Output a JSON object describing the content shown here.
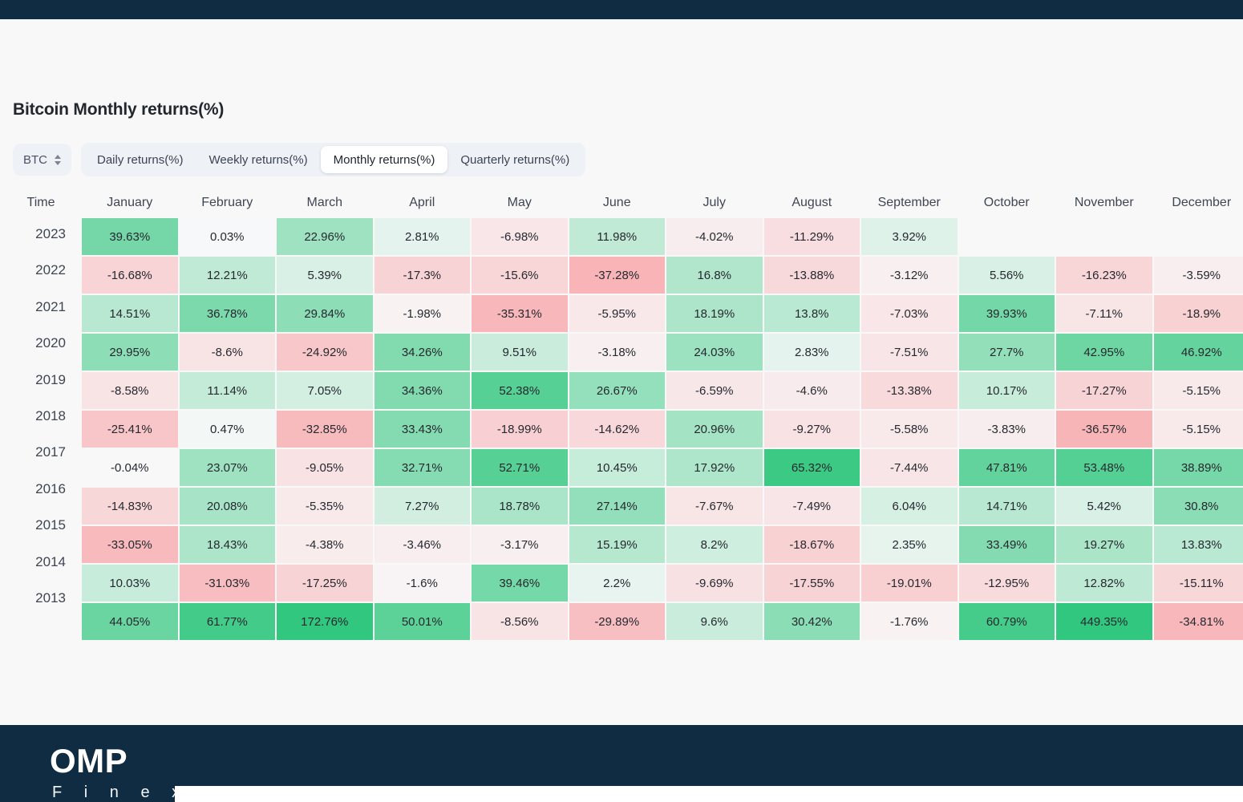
{
  "page": {
    "title": "Bitcoin Monthly returns(%)"
  },
  "toolbar": {
    "symbol_label": "BTC",
    "stepper_icon": "up-down-chevron-icon",
    "tabs": [
      {
        "label": "Daily returns(%)",
        "active": false
      },
      {
        "label": "Weekly returns(%)",
        "active": false
      },
      {
        "label": "Monthly returns(%)",
        "active": true
      },
      {
        "label": "Quarterly returns(%)",
        "active": false
      }
    ]
  },
  "footer": {
    "brand_primary": "OMP",
    "brand_secondary": "F i n e x",
    "background": "#0f2c42"
  },
  "colors": {
    "positive_max": "#32c77e",
    "negative_max": "#f8b4b7",
    "neutral": "#f8f8f9",
    "surface": "#f8f8f9",
    "tab_track": "#eef1f6",
    "tab_active": "#ffffff",
    "text": "#25292f"
  },
  "chart_data": {
    "type": "heatmap",
    "title": "Bitcoin Monthly returns(%)",
    "xlabel": "",
    "ylabel": "Time",
    "row_header": "Time",
    "categories": [
      "January",
      "February",
      "March",
      "April",
      "May",
      "June",
      "July",
      "August",
      "September",
      "October",
      "November",
      "December"
    ],
    "rows": [
      "2023",
      "2022",
      "2021",
      "2020",
      "2019",
      "2018",
      "2017",
      "2016",
      "2015",
      "2014",
      "2013"
    ],
    "unit": "%",
    "value_scale_positive_max": 449.35,
    "value_scale_negative_max": -37.28,
    "series": [
      {
        "name": "2023",
        "values": [
          39.63,
          0.03,
          22.96,
          2.81,
          -6.98,
          11.98,
          -4.02,
          -11.29,
          3.92,
          null,
          null,
          null
        ]
      },
      {
        "name": "2022",
        "values": [
          -16.68,
          12.21,
          5.39,
          -17.3,
          -15.6,
          -37.28,
          16.8,
          -13.88,
          -3.12,
          5.56,
          -16.23,
          -3.59
        ]
      },
      {
        "name": "2021",
        "values": [
          14.51,
          36.78,
          29.84,
          -1.98,
          -35.31,
          -5.95,
          18.19,
          13.8,
          -7.03,
          39.93,
          -7.11,
          -18.9
        ]
      },
      {
        "name": "2020",
        "values": [
          29.95,
          -8.6,
          -24.92,
          34.26,
          9.51,
          -3.18,
          24.03,
          2.83,
          -7.51,
          27.7,
          42.95,
          46.92
        ]
      },
      {
        "name": "2019",
        "values": [
          -8.58,
          11.14,
          7.05,
          34.36,
          52.38,
          26.67,
          -6.59,
          -4.6,
          -13.38,
          10.17,
          -17.27,
          -5.15
        ]
      },
      {
        "name": "2018",
        "values": [
          -25.41,
          0.47,
          -32.85,
          33.43,
          -18.99,
          -14.62,
          20.96,
          -9.27,
          -5.58,
          -3.83,
          -36.57,
          -5.15
        ]
      },
      {
        "name": "2017",
        "values": [
          -0.04,
          23.07,
          -9.05,
          32.71,
          52.71,
          10.45,
          17.92,
          65.32,
          -7.44,
          47.81,
          53.48,
          38.89
        ]
      },
      {
        "name": "2016",
        "values": [
          -14.83,
          20.08,
          -5.35,
          7.27,
          18.78,
          27.14,
          -7.67,
          -7.49,
          6.04,
          14.71,
          5.42,
          30.8
        ]
      },
      {
        "name": "2015",
        "values": [
          -33.05,
          18.43,
          -4.38,
          -3.46,
          -3.17,
          15.19,
          8.2,
          -18.67,
          2.35,
          33.49,
          19.27,
          13.83
        ]
      },
      {
        "name": "2014",
        "values": [
          10.03,
          -31.03,
          -17.25,
          -1.6,
          39.46,
          2.2,
          -9.69,
          -17.55,
          -19.01,
          -12.95,
          12.82,
          -15.11
        ]
      },
      {
        "name": "2013",
        "values": [
          44.05,
          61.77,
          172.76,
          50.01,
          -8.56,
          -29.89,
          9.6,
          30.42,
          -1.76,
          60.79,
          449.35,
          -34.81
        ]
      }
    ],
    "display_labels": [
      [
        "39.63%",
        "0.03%",
        "22.96%",
        "2.81%",
        "-6.98%",
        "11.98%",
        "-4.02%",
        "-11.29%",
        "3.92%",
        "",
        "",
        ""
      ],
      [
        "-16.68%",
        "12.21%",
        "5.39%",
        "-17.3%",
        "-15.6%",
        "-37.28%",
        "16.8%",
        "-13.88%",
        "-3.12%",
        "5.56%",
        "-16.23%",
        "-3.59%"
      ],
      [
        "14.51%",
        "36.78%",
        "29.84%",
        "-1.98%",
        "-35.31%",
        "-5.95%",
        "18.19%",
        "13.8%",
        "-7.03%",
        "39.93%",
        "-7.11%",
        "-18.9%"
      ],
      [
        "29.95%",
        "-8.6%",
        "-24.92%",
        "34.26%",
        "9.51%",
        "-3.18%",
        "24.03%",
        "2.83%",
        "-7.51%",
        "27.7%",
        "42.95%",
        "46.92%"
      ],
      [
        "-8.58%",
        "11.14%",
        "7.05%",
        "34.36%",
        "52.38%",
        "26.67%",
        "-6.59%",
        "-4.6%",
        "-13.38%",
        "10.17%",
        "-17.27%",
        "-5.15%"
      ],
      [
        "-25.41%",
        "0.47%",
        "-32.85%",
        "33.43%",
        "-18.99%",
        "-14.62%",
        "20.96%",
        "-9.27%",
        "-5.58%",
        "-3.83%",
        "-36.57%",
        "-5.15%"
      ],
      [
        "-0.04%",
        "23.07%",
        "-9.05%",
        "32.71%",
        "52.71%",
        "10.45%",
        "17.92%",
        "65.32%",
        "-7.44%",
        "47.81%",
        "53.48%",
        "38.89%"
      ],
      [
        "-14.83%",
        "20.08%",
        "-5.35%",
        "7.27%",
        "18.78%",
        "27.14%",
        "-7.67%",
        "-7.49%",
        "6.04%",
        "14.71%",
        "5.42%",
        "30.8%"
      ],
      [
        "-33.05%",
        "18.43%",
        "-4.38%",
        "-3.46%",
        "-3.17%",
        "15.19%",
        "8.2%",
        "-18.67%",
        "2.35%",
        "33.49%",
        "19.27%",
        "13.83%"
      ],
      [
        "10.03%",
        "-31.03%",
        "-17.25%",
        "-1.6%",
        "39.46%",
        "2.2%",
        "-9.69%",
        "-17.55%",
        "-19.01%",
        "-12.95%",
        "12.82%",
        "-15.11%"
      ],
      [
        "44.05%",
        "61.77%",
        "172.76%",
        "50.01%",
        "-8.56%",
        "-29.89%",
        "9.6%",
        "30.42%",
        "-1.76%",
        "60.79%",
        "449.35%",
        "-34.81%"
      ]
    ]
  }
}
